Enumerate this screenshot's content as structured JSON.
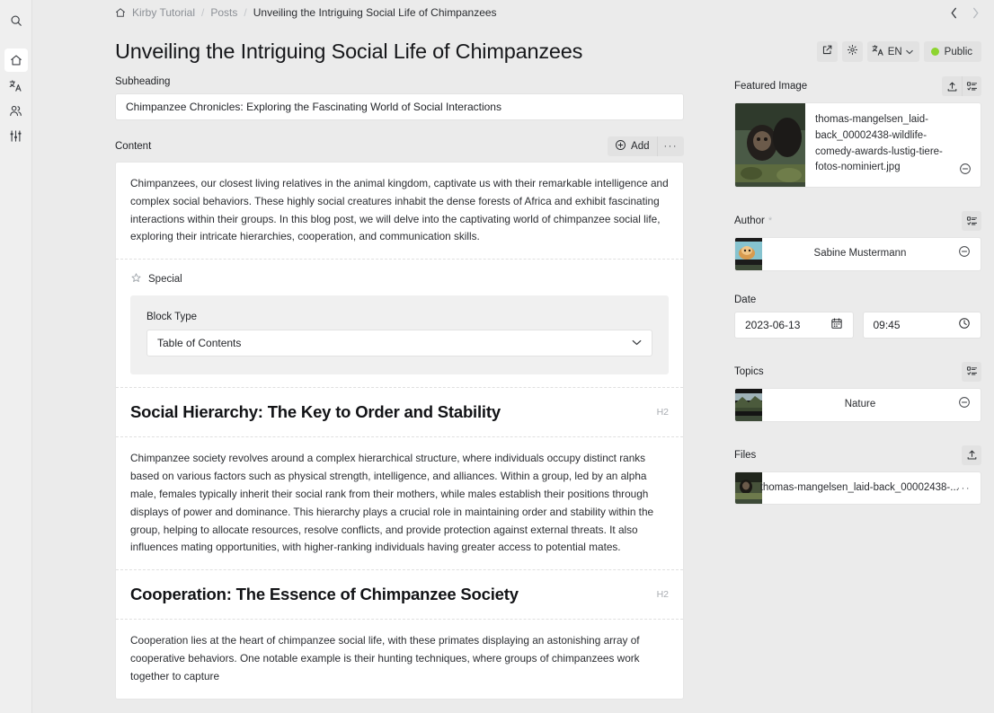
{
  "rail": {
    "items": [
      {
        "name": "search-icon",
        "label": "Search",
        "active": false
      },
      {
        "name": "home-icon",
        "label": "Site",
        "active": true
      },
      {
        "name": "languages-icon",
        "label": "Languages",
        "active": false
      },
      {
        "name": "users-icon",
        "label": "Users",
        "active": false
      },
      {
        "name": "sliders-icon",
        "label": "System",
        "active": false
      }
    ]
  },
  "breadcrumb": {
    "home_icon": "home-icon",
    "items": [
      {
        "label": "Kirby Tutorial",
        "current": false
      },
      {
        "label": "Posts",
        "current": false
      },
      {
        "label": "Unveiling the Intriguing Social Life of Chimpanzees",
        "current": true
      }
    ],
    "separator": "/"
  },
  "nav": {
    "prev": "chevron-left-icon",
    "next": "chevron-right-icon"
  },
  "header": {
    "title": "Unveiling the Intriguing Social Life of Chimpanzees",
    "preview_icon": "external-link-icon",
    "settings_icon": "gear-icon",
    "language": {
      "icon": "translate-icon",
      "value": "EN",
      "caret": "chevron-down-icon"
    },
    "status": {
      "label": "Public",
      "color": "#8dd42f"
    }
  },
  "main": {
    "subheading": {
      "label": "Subheading",
      "value": "Chimpanzee Chronicles: Exploring the Fascinating World of Social Interactions",
      "placeholder": "Subheading"
    },
    "content": {
      "label": "Content",
      "add_label": "Add",
      "add_icon": "plus-circle-icon",
      "more_icon": "ellipsis-icon",
      "blocks": [
        {
          "type": "text",
          "text": "Chimpanzees, our closest living relatives in the animal kingdom, captivate us with their remarkable intelligence and complex social behaviors. These highly social creatures inhabit the dense forests of Africa and exhibit fascinating interactions within their groups. In this blog post, we will delve into the captivating world of chimpanzee social life, exploring their intricate hierarchies, cooperation, and communication skills."
        },
        {
          "type": "special",
          "label": "Special",
          "icon": "star-outline-icon",
          "field_label": "Block Type",
          "value": "Table of Contents",
          "options": [
            "Table of Contents"
          ]
        },
        {
          "type": "heading",
          "text": "Social Hierarchy: The Key to Order and Stability",
          "tag": "H2"
        },
        {
          "type": "text",
          "text": "Chimpanzee society revolves around a complex hierarchical structure, where individuals occupy distinct ranks based on various factors such as physical strength, intelligence, and alliances. Within a group, led by an alpha male, females typically inherit their social rank from their mothers, while males establish their positions through displays of power and dominance. This hierarchy plays a crucial role in maintaining order and stability within the group, helping to allocate resources, resolve conflicts, and provide protection against external threats. It also influences mating opportunities, with higher-ranking individuals having greater access to potential mates."
        },
        {
          "type": "heading",
          "text": "Cooperation: The Essence of Chimpanzee Society",
          "tag": "H2"
        },
        {
          "type": "text",
          "text": "Cooperation lies at the heart of chimpanzee social life, with these primates displaying an astonishing array of cooperative behaviors. One notable example is their hunting techniques, where groups of chimpanzees work together to capture"
        }
      ]
    }
  },
  "sidebar": {
    "featured_image": {
      "label": "Featured Image",
      "upload_icon": "upload-icon",
      "select_icon": "checklist-icon",
      "filename": "thomas-mangelsen_laid-back_00002438-wildlife-comedy-awards-lustig-tiere-fotos-nominiert.jpg",
      "remove_icon": "minus-circle-icon"
    },
    "author": {
      "label": "Author",
      "required_marker": "*",
      "select_icon": "checklist-icon",
      "name": "Sabine Mustermann",
      "remove_icon": "minus-circle-icon"
    },
    "date": {
      "label": "Date",
      "date_value": "2023-06-13",
      "date_icon": "calendar-icon",
      "time_value": "09:45",
      "time_icon": "clock-icon"
    },
    "topics": {
      "label": "Topics",
      "select_icon": "checklist-icon",
      "items": [
        {
          "name": "Nature",
          "remove_icon": "minus-circle-icon"
        }
      ]
    },
    "files": {
      "label": "Files",
      "upload_icon": "upload-icon",
      "items": [
        {
          "name": "thomas-mangelsen_laid-back_00002438-...",
          "more_icon": "ellipsis-icon"
        }
      ]
    }
  }
}
